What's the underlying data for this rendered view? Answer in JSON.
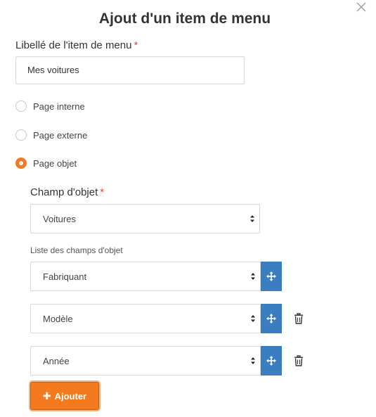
{
  "dialog": {
    "title": "Ajout d'un item de menu",
    "close_icon": "close-icon"
  },
  "label_field": {
    "label": "Libellé de l'item de menu",
    "required_mark": "*",
    "value": "Mes voitures"
  },
  "link_type": {
    "options": [
      {
        "label": "Page interne",
        "checked": false
      },
      {
        "label": "Page externe",
        "checked": false
      },
      {
        "label": "Page objet",
        "checked": true
      }
    ]
  },
  "object_field": {
    "label": "Champ d'objet",
    "required_mark": "*",
    "selected": "Voitures"
  },
  "object_fields_list": {
    "label": "Liste des champs d'objet",
    "rows": [
      {
        "selected": "Fabriquant",
        "deletable": false
      },
      {
        "selected": "Modèle",
        "deletable": true
      },
      {
        "selected": "Année",
        "deletable": true
      }
    ]
  },
  "add_button": {
    "icon": "plus-icon",
    "label": "Ajouter"
  },
  "colors": {
    "accent": "#f47a1f",
    "drag_button": "#3a7ec1",
    "required": "#e8473c"
  }
}
